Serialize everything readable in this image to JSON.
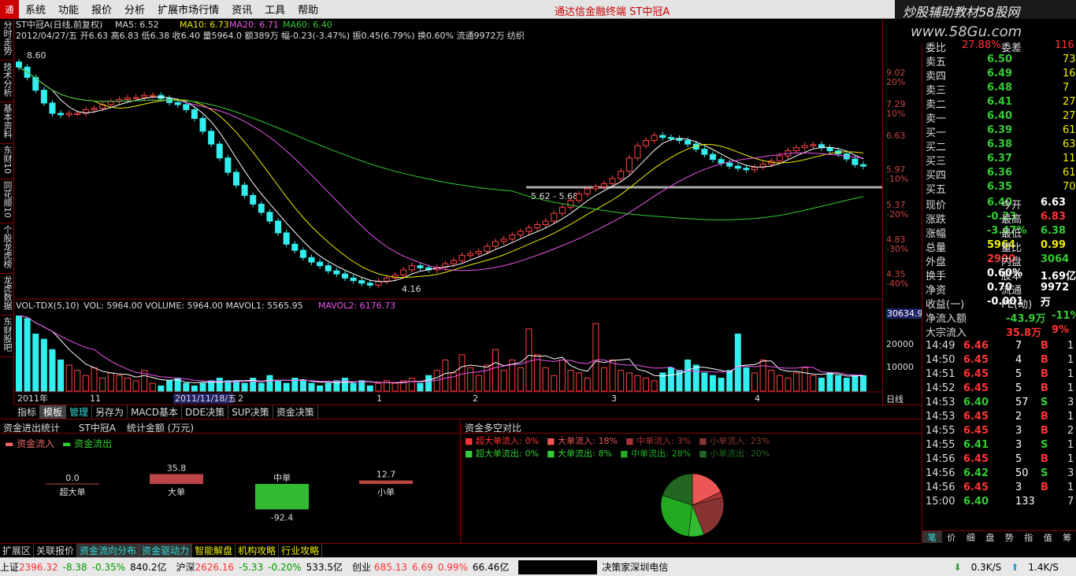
{
  "app_menu": [
    "系统",
    "功能",
    "报价",
    "分析",
    "扩展市场行情",
    "资讯",
    "工具",
    "帮助"
  ],
  "window_title": "通达信金融终端   ST中冠A",
  "brand": "炒股辅助教材58股网",
  "brand_url": "www.58Gu.com",
  "left_tabs": [
    "分时走势",
    "技术分析",
    "基本资料",
    "东财10",
    "同花顺10",
    "个股龙虎榜",
    "龙虎数据",
    "东财股吧"
  ],
  "chart": {
    "title": "ST中冠A(日线,前复权)",
    "ma5": "MA5: 6.52",
    "ma10": "MA10: 6.73",
    "ma20": "MA20: 6.71",
    "ma60": "MA60: 6.40",
    "info": "2012/04/27/五 开6.63 高6.83 低6.38 收6.40 量5964.0 额389万 幅-0.23(-3.47%) 振0.45(6.79%) 换0.60% 流通9972万 纺织",
    "high_label": "8.60",
    "low_label": "4.16",
    "range_label": "5.62 - 5.68",
    "price_ticks": [
      "9.02",
      "20%",
      "7.29",
      "10%",
      "6.63",
      "5.97",
      "-10%",
      "5.37",
      "-20%",
      "4.83",
      "-30%",
      "4.35",
      "-40%"
    ],
    "vol_title": "VOL-TDX(5,10)",
    "vol_vals": "VOL: 5964.00  VOLUME: 5964.00  MAVOL1: 5565.95",
    "mavol2": "MAVOL2: 6176.73",
    "vol_ticks": [
      "30634.97",
      "20000",
      "10000"
    ],
    "date_labels": [
      "2011年",
      "11",
      "2011/11/18/五",
      "2",
      "1",
      "2",
      "3",
      "4"
    ],
    "bottom_right": "日线",
    "closes": [
      8.45,
      8.25,
      8.0,
      7.75,
      7.55,
      7.52,
      7.55,
      7.55,
      7.62,
      7.65,
      7.72,
      7.78,
      7.82,
      7.85,
      7.86,
      7.9,
      7.9,
      7.84,
      7.76,
      7.72,
      7.62,
      7.45,
      7.2,
      6.95,
      6.68,
      6.4,
      6.15,
      5.95,
      5.78,
      5.62,
      5.45,
      5.22,
      5.0,
      4.88,
      4.74,
      4.65,
      4.58,
      4.48,
      4.42,
      4.34,
      4.29,
      4.24,
      4.2,
      4.28,
      4.34,
      4.4,
      4.5,
      4.58,
      4.54,
      4.5,
      4.55,
      4.62,
      4.68,
      4.78,
      4.82,
      4.86,
      4.96,
      5.05,
      5.1,
      5.18,
      5.25,
      5.32,
      5.38,
      5.45,
      5.6,
      5.72,
      5.85,
      5.98,
      6.08,
      6.12,
      6.18,
      6.28,
      6.42,
      6.68,
      6.92,
      7.02,
      7.12,
      7.08,
      7.06,
      7.02,
      6.95,
      6.85,
      6.75,
      6.65,
      6.58,
      6.52,
      6.48,
      6.45,
      6.5,
      6.56,
      6.62,
      6.72,
      6.82,
      6.88,
      6.92,
      6.94,
      6.88,
      6.82,
      6.76,
      6.66,
      6.55,
      6.52
    ],
    "volumes": [
      29000,
      28000,
      22000,
      20000,
      16000,
      12000,
      10000,
      8000,
      6000,
      9000,
      5000,
      7000,
      6000,
      5000,
      4000,
      8000,
      3000,
      2000,
      4000,
      5000,
      3000,
      2000,
      3000,
      4000,
      5000,
      4000,
      4000,
      3000,
      5000,
      3000,
      6000,
      4000,
      3000,
      5000,
      4000,
      3000,
      2000,
      3000,
      4000,
      5000,
      3000,
      4000,
      2000,
      3000,
      4000,
      3000,
      4000,
      5000,
      3000,
      6000,
      8000,
      12000,
      7000,
      14000,
      9000,
      6000,
      10000,
      16000,
      8000,
      12000,
      9000,
      24000,
      14000,
      9000,
      6000,
      12000,
      8000,
      7000,
      5000,
      26000,
      9000,
      12000,
      8000,
      7000,
      6000,
      5000,
      4000,
      7000,
      9000,
      8000,
      12000,
      10000,
      7000,
      6000,
      5000,
      8000,
      22000,
      9000,
      7000,
      12000,
      8000,
      6000,
      5000,
      7000,
      9000,
      6000,
      5000,
      7000,
      6000,
      5000,
      6000,
      5964
    ]
  },
  "quote": {
    "header_left": "委比",
    "header_left_val": "27.88%",
    "header_right": "委差",
    "header_right_val": "116",
    "sells": [
      {
        "l": "卖五",
        "p": "6.50",
        "v": "73"
      },
      {
        "l": "卖四",
        "p": "6.49",
        "v": "16"
      },
      {
        "l": "卖三",
        "p": "6.48",
        "v": "7"
      },
      {
        "l": "卖二",
        "p": "6.41",
        "v": "27"
      },
      {
        "l": "卖一",
        "p": "6.40",
        "v": "27"
      }
    ],
    "buys": [
      {
        "l": "买一",
        "p": "6.39",
        "v": "61"
      },
      {
        "l": "买二",
        "p": "6.38",
        "v": "63"
      },
      {
        "l": "买三",
        "p": "6.37",
        "v": "11"
      },
      {
        "l": "买四",
        "p": "6.36",
        "v": "61"
      },
      {
        "l": "买五",
        "p": "6.35",
        "v": "70"
      }
    ],
    "stats": [
      {
        "a": "现价",
        "av": "6.40",
        "b": "今开",
        "bv": "6.63"
      },
      {
        "a": "涨跌",
        "av": "-0.23",
        "b": "最高",
        "bv": "6.83"
      },
      {
        "a": "涨幅",
        "av": "-3.47%",
        "b": "最低",
        "bv": "6.38"
      },
      {
        "a": "总量",
        "av": "5964",
        "b": "量比",
        "bv": "0.99"
      },
      {
        "a": "外盘",
        "av": "2900",
        "b": "内盘",
        "bv": "3064"
      },
      {
        "a": "换手",
        "av": "0.60%",
        "b": "股本",
        "bv": "1.69亿"
      },
      {
        "a": "净资",
        "av": "0.70",
        "b": "流通",
        "bv": "9972万"
      },
      {
        "a": "收益(一)",
        "av": "-0.001",
        "b": "PE(动)",
        "bv": "-"
      }
    ],
    "flow": [
      {
        "a": "净流入额",
        "v": "-43.9万",
        "p": "-11%"
      },
      {
        "a": "大宗流入",
        "v": "35.8万",
        "p": "9%"
      }
    ],
    "ticks": [
      {
        "t": "14:49",
        "p": "6.46",
        "v": "7",
        "d": "B",
        "n": "1"
      },
      {
        "t": "14:50",
        "p": "6.45",
        "v": "4",
        "d": "B",
        "n": "1"
      },
      {
        "t": "14:51",
        "p": "6.45",
        "v": "5",
        "d": "B",
        "n": "1"
      },
      {
        "t": "14:52",
        "p": "6.45",
        "v": "5",
        "d": "B",
        "n": "1"
      },
      {
        "t": "14:53",
        "p": "6.40",
        "v": "57",
        "d": "S",
        "n": "3"
      },
      {
        "t": "14:53",
        "p": "6.45",
        "v": "2",
        "d": "B",
        "n": "1"
      },
      {
        "t": "14:55",
        "p": "6.45",
        "v": "3",
        "d": "B",
        "n": "2"
      },
      {
        "t": "14:55",
        "p": "6.41",
        "v": "3",
        "d": "S",
        "n": "1"
      },
      {
        "t": "14:56",
        "p": "6.45",
        "v": "5",
        "d": "B",
        "n": "1"
      },
      {
        "t": "14:56",
        "p": "6.42",
        "v": "50",
        "d": "S",
        "n": "3"
      },
      {
        "t": "14:56",
        "p": "6.45",
        "v": "3",
        "d": "B",
        "n": "1"
      },
      {
        "t": "15:00",
        "p": "6.40",
        "v": "133",
        "d": "",
        "n": "7"
      }
    ],
    "bottom_tabs": [
      "笔",
      "价",
      "细",
      "盘",
      "势",
      "指",
      "值",
      "筹"
    ]
  },
  "tabs": [
    "指标",
    "模板",
    "管理",
    "另存为",
    "MACD基本",
    "DDE决策",
    "SUP决策",
    "资金决策"
  ],
  "panel_left": {
    "title": "资金进出统计",
    "stock": "ST中冠A",
    "unit": "统计金额 (万元)",
    "legend_in": "资金流入",
    "legend_out": "资金流出",
    "bars": [
      {
        "name": "超大单",
        "val": "0.0",
        "num": 0
      },
      {
        "name": "大单",
        "val": "35.8",
        "num": 35.8
      },
      {
        "name": "中单",
        "val": "-92.4",
        "num": -92.4
      },
      {
        "name": "小单",
        "val": "12.7",
        "num": 12.7
      }
    ]
  },
  "panel_right": {
    "title": "资金多空对比",
    "row1": [
      {
        "k": "超大单流入:",
        "v": "0%"
      },
      {
        "k": "大单流入:",
        "v": "18%"
      },
      {
        "k": "中单流入:",
        "v": "3%"
      },
      {
        "k": "小单流入:",
        "v": "23%"
      }
    ],
    "row2": [
      {
        "k": "超大单流出:",
        "v": "0%"
      },
      {
        "k": "大单流出:",
        "v": "8%"
      },
      {
        "k": "中单流出:",
        "v": "28%"
      },
      {
        "k": "小单流出:",
        "v": "20%"
      }
    ]
  },
  "bottom_tabs": [
    "扩展区",
    "关联报价",
    "资金流向分布",
    "资金驱动力",
    "智能解盘",
    "机构攻略",
    "行业攻略"
  ],
  "status": {
    "sh": "上证",
    "sh_v": "2396.32",
    "sh_c": "-8.38",
    "sh_p": "-0.35%",
    "sh_a": "840.2亿",
    "hs": "沪深",
    "hs_v": "2626.16",
    "hs_c": "-5.33",
    "hs_p": "-0.20%",
    "hs_a": "533.5亿",
    "cy": "创业",
    "cy_v": "685.13",
    "cy_c": "6.69",
    "cy_p": "0.99%",
    "cy_a": "66.46亿",
    "server": "决策家深圳电信",
    "down": "0.3K/S",
    "up": "1.4K/S"
  }
}
